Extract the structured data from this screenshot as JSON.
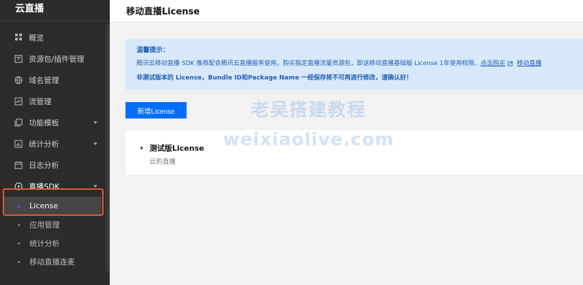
{
  "sidebar": {
    "title": "云直播",
    "items": [
      {
        "label": "概览",
        "icon": "grid-icon",
        "has_arrow": false
      },
      {
        "label": "资源包/插件管理",
        "icon": "package-icon",
        "has_arrow": false
      },
      {
        "label": "域名管理",
        "icon": "globe-icon",
        "has_arrow": false
      },
      {
        "label": "流管理",
        "icon": "stream-icon",
        "has_arrow": false
      },
      {
        "label": "功能模板",
        "icon": "template-icon",
        "has_arrow": true
      },
      {
        "label": "统计分析",
        "icon": "chart-icon",
        "has_arrow": true
      },
      {
        "label": "日志分析",
        "icon": "calendar-icon",
        "has_arrow": false
      },
      {
        "label": "直播SDK",
        "icon": "play-icon",
        "has_arrow": true
      }
    ],
    "sdk_sub_items": [
      {
        "label": "License",
        "active": true
      },
      {
        "label": "应用管理",
        "active": false
      },
      {
        "label": "统计分析",
        "active": false
      },
      {
        "label": "移动直播连麦",
        "active": false
      }
    ]
  },
  "header": {
    "title": "移动直播License"
  },
  "notice": {
    "title": "温馨提示：",
    "line1_text": "腾讯云移动直播 SDK 推荐配合腾讯云直播服务使用，购买指定直播流量资源包，即送移动直播基础版 License 1年使用权限。",
    "line1_link": "点击购买",
    "line1_link2": "移动直播",
    "line2_text": "非测试版本的 License，Bundle ID和Package Name 一经保存将不可再进行修改，请确认好！"
  },
  "actions": {
    "new_license_label": "新增License"
  },
  "license_card": {
    "title": "测试版License",
    "subtitle": "云豹直播"
  },
  "watermark": {
    "line1": "老吴搭建教程",
    "line2": "weixiaolive.com"
  },
  "colors": {
    "accent": "#006eff",
    "sidebar_bg": "#2b2b2b",
    "notice_bg": "#d8e9fb",
    "highlight": "#e25a33"
  }
}
